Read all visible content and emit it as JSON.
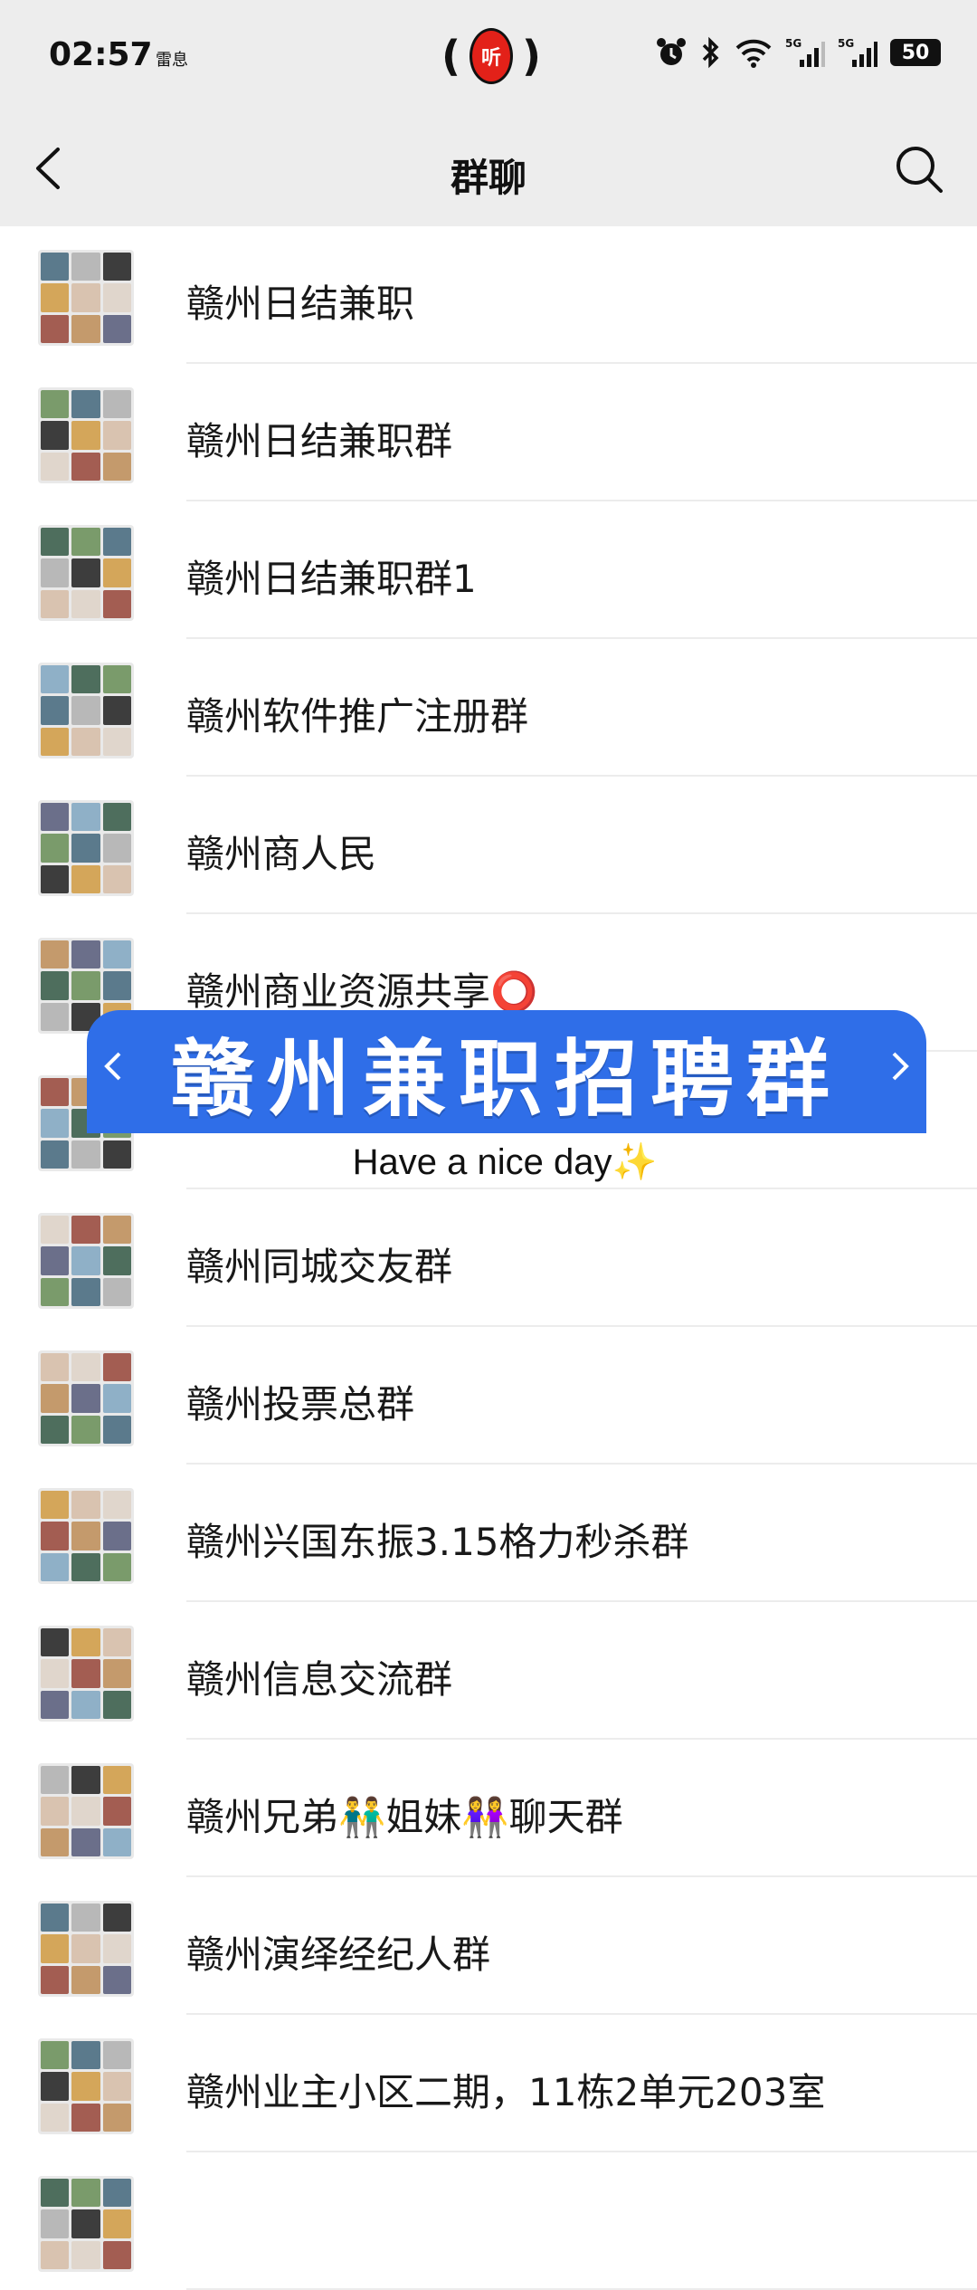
{
  "status_bar": {
    "time": "02:57",
    "carrier": "雷息",
    "center_app": "听",
    "battery": "50"
  },
  "nav": {
    "title": "群聊"
  },
  "groups": [
    {
      "name": "赣州日结兼职"
    },
    {
      "name": "赣州日结兼职群"
    },
    {
      "name": "赣州日结兼职群1"
    },
    {
      "name": "赣州软件推广注册群"
    },
    {
      "name": "赣州商人民"
    },
    {
      "name": "赣州商业资源共享⭕"
    },
    {
      "name": ""
    },
    {
      "name": "赣州同城交友群"
    },
    {
      "name": "赣州投票总群"
    },
    {
      "name": "赣州兴国东振3.15格力秒杀群"
    },
    {
      "name": "赣州信息交流群"
    },
    {
      "name": "赣州兄弟👬姐妹👭聊天群"
    },
    {
      "name": "赣州演绎经纪人群"
    },
    {
      "name": "赣州业主小区二期，11栋2单元203室"
    },
    {
      "name": ""
    }
  ],
  "overlay": {
    "title": "赣州兼职招聘群",
    "tagline": "Have a nice day✨"
  },
  "colors": {
    "header_bg": "#ededed",
    "banner_blue": "#2f6ee8",
    "badge_red": "#e32119"
  }
}
